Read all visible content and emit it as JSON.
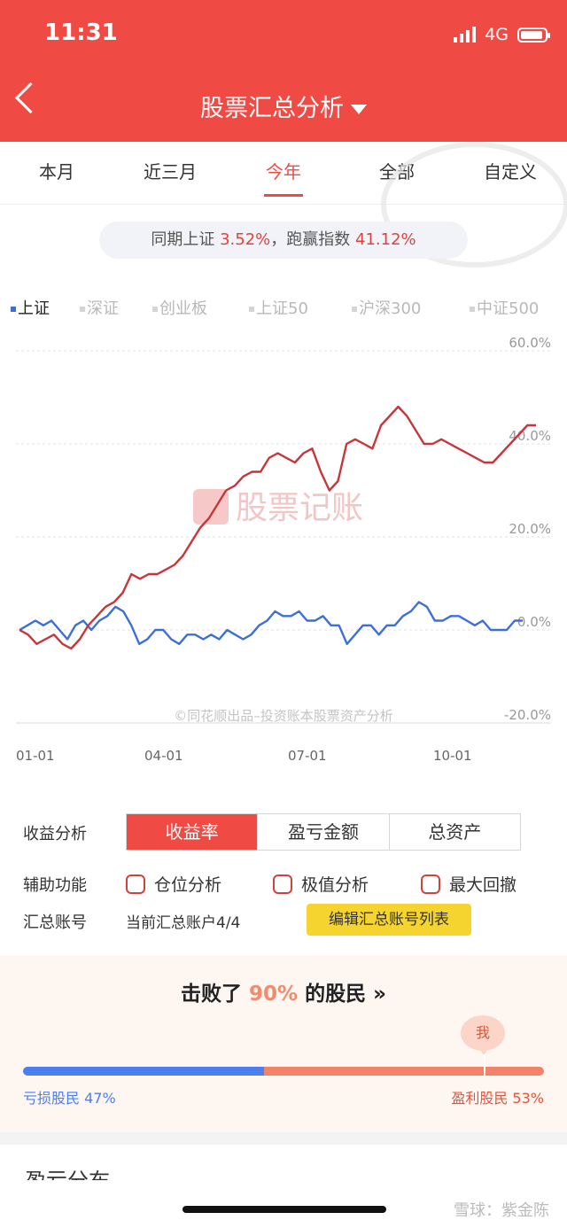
{
  "status": {
    "time": "11:31",
    "network": "4G"
  },
  "header": {
    "title": "股票汇总分析"
  },
  "tabs": [
    {
      "label": "本月",
      "active": false
    },
    {
      "label": "近三月",
      "active": false
    },
    {
      "label": "今年",
      "active": true
    },
    {
      "label": "全部",
      "active": false
    },
    {
      "label": "自定义",
      "active": false
    }
  ],
  "summary": {
    "prefix": "同期上证",
    "index_return": "3.52%",
    "middle": "，跑赢指数",
    "excess_return": "41.12%"
  },
  "legend": [
    "上证",
    "深证",
    "创业板",
    "上证50",
    "沪深300",
    "中证500"
  ],
  "legend_active": "上证",
  "chart_watermark": "股票记账",
  "chart_credit": "©同花顺出品–投资账本股票资产分析",
  "chart_data": {
    "type": "line",
    "x_ticks": [
      "01-01",
      "04-01",
      "07-01",
      "10-01"
    ],
    "y_ticks": [
      "60.0%",
      "40.0%",
      "20.0%",
      "0.0%",
      "-20.0%"
    ],
    "ylim": [
      -20,
      60
    ],
    "grid": true,
    "series": [
      {
        "name": "上证",
        "color": "#3d6fd9",
        "values": [
          0,
          1,
          2,
          1,
          2,
          0,
          -2,
          1,
          2,
          0,
          2,
          3,
          5,
          4,
          1,
          -3,
          -2,
          0,
          0,
          -2,
          -3,
          -1,
          -1,
          -2,
          -1,
          -2,
          0,
          -1,
          -2,
          -1,
          1,
          2,
          4,
          3,
          3,
          4,
          2,
          2,
          3,
          1,
          1,
          -3,
          -1,
          1,
          1,
          -1,
          1,
          1,
          3,
          4,
          6,
          5,
          2,
          2,
          3,
          3,
          2,
          1,
          2,
          0,
          0,
          0,
          2,
          2
        ]
      },
      {
        "name": "收益率",
        "color": "#c8353a",
        "values": [
          0,
          -1,
          -3,
          -2,
          -1,
          -3,
          -4,
          -2,
          1,
          3,
          5,
          6,
          8,
          12,
          11,
          12,
          12,
          13,
          14,
          16,
          19,
          22,
          24,
          27,
          30,
          31,
          33,
          34,
          34,
          37,
          38,
          37,
          36,
          38,
          39,
          34,
          30,
          32,
          40,
          41,
          40,
          39,
          44,
          46,
          48,
          46,
          43,
          40,
          40,
          41,
          40,
          39,
          38,
          37,
          36,
          36,
          38,
          40,
          42,
          44,
          44
        ]
      }
    ]
  },
  "controls": {
    "profit_label": "收益分析",
    "segments": [
      "收益率",
      "盈亏金额",
      "总资产"
    ],
    "aux_label": "辅助功能",
    "checkboxes": [
      "仓位分析",
      "极值分析",
      "最大回撤"
    ],
    "account_label": "汇总账号",
    "account_value": "当前汇总账户4/4",
    "edit_button": "编辑汇总账号列表"
  },
  "beat": {
    "prefix": "击败了",
    "percent": "90%",
    "suffix": "的股民 »",
    "me": "我",
    "loss_label": "亏损股民  47%",
    "gain_label": "盈利股民  53%"
  },
  "next_section_title": "盈亏分布",
  "footer_watermark": "雪球：紫金陈"
}
